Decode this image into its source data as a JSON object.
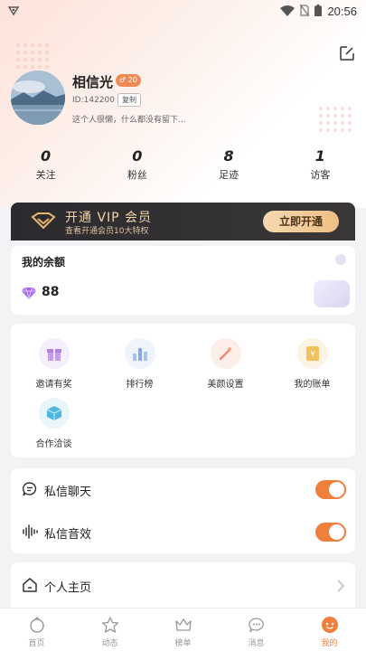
{
  "status_bar": {
    "time": "20:56"
  },
  "profile": {
    "name": "相信光",
    "gender_badge": "♂ 20",
    "id_text": "ID:142200",
    "copy_label": "复制",
    "bio": "这个人很懒，什么都没有留下..."
  },
  "stats": [
    {
      "value": "0",
      "label": "关注"
    },
    {
      "value": "0",
      "label": "粉丝"
    },
    {
      "value": "8",
      "label": "足迹"
    },
    {
      "value": "1",
      "label": "访客"
    }
  ],
  "vip": {
    "title": "开通 VIP 会员",
    "subtitle": "查看开通会员10大特权",
    "button_label": "立即开通"
  },
  "balance": {
    "title": "我的余额",
    "amount": "88"
  },
  "features": [
    {
      "label": "邀请有奖",
      "icon": "gift-icon"
    },
    {
      "label": "排行榜",
      "icon": "ranking-icon"
    },
    {
      "label": "美颜设置",
      "icon": "magic-wand-icon"
    },
    {
      "label": "我的账单",
      "icon": "bill-icon"
    },
    {
      "label": "合作洽谈",
      "icon": "cube-icon"
    }
  ],
  "settings": [
    {
      "label": "私信聊天",
      "icon": "chat-bubble-icon",
      "enabled": true
    },
    {
      "label": "私信音效",
      "icon": "sound-wave-icon",
      "enabled": true
    }
  ],
  "homepage": {
    "label": "个人主页"
  },
  "nav": [
    {
      "label": "首页",
      "icon": "home-icon",
      "active": false
    },
    {
      "label": "动态",
      "icon": "star-face-icon",
      "active": false
    },
    {
      "label": "榜单",
      "icon": "crown-icon",
      "active": false
    },
    {
      "label": "消息",
      "icon": "message-icon",
      "active": false
    },
    {
      "label": "我的",
      "icon": "profile-face-icon",
      "active": true
    }
  ],
  "colors": {
    "accent": "#f07f3c",
    "vip_gold": "#f1d4a8",
    "background": "#f3f3f5"
  }
}
